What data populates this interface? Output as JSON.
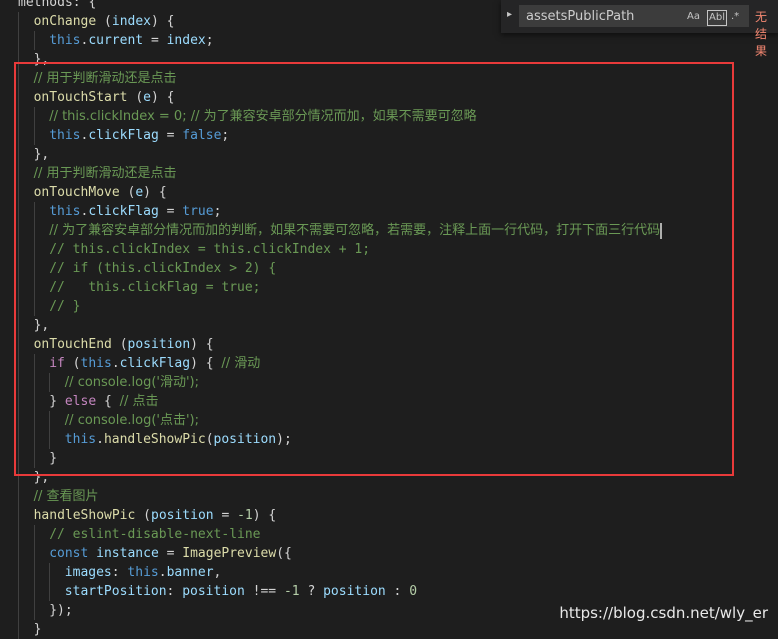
{
  "editor": {
    "lines": [
      {
        "indent": 0,
        "tokens": [
          {
            "t": "methods: {",
            "c": "pun"
          }
        ]
      },
      {
        "indent": 1,
        "tokens": [
          {
            "t": "onChange",
            "c": "fn"
          },
          {
            "t": " (",
            "c": "pun"
          },
          {
            "t": "index",
            "c": "key"
          },
          {
            "t": ") {",
            "c": "pun"
          }
        ]
      },
      {
        "indent": 2,
        "tokens": [
          {
            "t": "this",
            "c": "kw"
          },
          {
            "t": ".",
            "c": "pun"
          },
          {
            "t": "current",
            "c": "key"
          },
          {
            "t": " = ",
            "c": "pun"
          },
          {
            "t": "index",
            "c": "key"
          },
          {
            "t": ";",
            "c": "pun"
          }
        ]
      },
      {
        "indent": 1,
        "tokens": [
          {
            "t": "},",
            "c": "pun"
          }
        ]
      },
      {
        "indent": 1,
        "tokens": [
          {
            "t": "// 用于判断滑动还是点击",
            "c": "cm"
          }
        ]
      },
      {
        "indent": 1,
        "tokens": [
          {
            "t": "onTouchStart",
            "c": "fn"
          },
          {
            "t": " (",
            "c": "pun"
          },
          {
            "t": "e",
            "c": "key"
          },
          {
            "t": ") {",
            "c": "pun"
          }
        ]
      },
      {
        "indent": 2,
        "tokens": [
          {
            "t": "// this.clickIndex = 0; // 为了兼容安卓部分情况而加，如果不需要可忽略",
            "c": "cm"
          }
        ]
      },
      {
        "indent": 2,
        "tokens": [
          {
            "t": "this",
            "c": "kw"
          },
          {
            "t": ".",
            "c": "pun"
          },
          {
            "t": "clickFlag",
            "c": "key"
          },
          {
            "t": " = ",
            "c": "pun"
          },
          {
            "t": "false",
            "c": "kw"
          },
          {
            "t": ";",
            "c": "pun"
          }
        ]
      },
      {
        "indent": 1,
        "tokens": [
          {
            "t": "},",
            "c": "pun"
          }
        ]
      },
      {
        "indent": 1,
        "tokens": [
          {
            "t": "// 用于判断滑动还是点击",
            "c": "cm"
          }
        ]
      },
      {
        "indent": 1,
        "tokens": [
          {
            "t": "onTouchMove",
            "c": "fn"
          },
          {
            "t": " (",
            "c": "pun"
          },
          {
            "t": "e",
            "c": "key"
          },
          {
            "t": ") {",
            "c": "pun"
          }
        ]
      },
      {
        "indent": 2,
        "tokens": [
          {
            "t": "this",
            "c": "kw"
          },
          {
            "t": ".",
            "c": "pun"
          },
          {
            "t": "clickFlag",
            "c": "key"
          },
          {
            "t": " = ",
            "c": "pun"
          },
          {
            "t": "true",
            "c": "kw"
          },
          {
            "t": ";",
            "c": "pun"
          }
        ]
      },
      {
        "indent": 2,
        "cursor": true,
        "tokens": [
          {
            "t": "// 为了兼容安卓部分情况而加的判断，如果不需要可忽略，若需要，注释上面一行代码，打开下面三行代码",
            "c": "cm"
          }
        ]
      },
      {
        "indent": 2,
        "tokens": [
          {
            "t": "// this.clickIndex = this.clickIndex + 1;",
            "c": "cm"
          }
        ]
      },
      {
        "indent": 2,
        "tokens": [
          {
            "t": "// if (this.clickIndex > 2) {",
            "c": "cm"
          }
        ]
      },
      {
        "indent": 2,
        "tokens": [
          {
            "t": "//   this.clickFlag = true;",
            "c": "cm"
          }
        ]
      },
      {
        "indent": 2,
        "tokens": [
          {
            "t": "// }",
            "c": "cm"
          }
        ]
      },
      {
        "indent": 1,
        "tokens": [
          {
            "t": "},",
            "c": "pun"
          }
        ]
      },
      {
        "indent": 1,
        "tokens": [
          {
            "t": "onTouchEnd",
            "c": "fn"
          },
          {
            "t": " (",
            "c": "pun"
          },
          {
            "t": "position",
            "c": "key"
          },
          {
            "t": ") {",
            "c": "pun"
          }
        ]
      },
      {
        "indent": 2,
        "tokens": [
          {
            "t": "if",
            "c": "ctl"
          },
          {
            "t": " (",
            "c": "pun"
          },
          {
            "t": "this",
            "c": "kw"
          },
          {
            "t": ".",
            "c": "pun"
          },
          {
            "t": "clickFlag",
            "c": "key"
          },
          {
            "t": ") { ",
            "c": "pun"
          },
          {
            "t": "// 滑动",
            "c": "cm"
          }
        ]
      },
      {
        "indent": 3,
        "tokens": [
          {
            "t": "// console.log('滑动');",
            "c": "cm"
          }
        ]
      },
      {
        "indent": 2,
        "tokens": [
          {
            "t": "} ",
            "c": "pun"
          },
          {
            "t": "else",
            "c": "ctl"
          },
          {
            "t": " { ",
            "c": "pun"
          },
          {
            "t": "// 点击",
            "c": "cm"
          }
        ]
      },
      {
        "indent": 3,
        "tokens": [
          {
            "t": "// console.log('点击');",
            "c": "cm"
          }
        ]
      },
      {
        "indent": 3,
        "tokens": [
          {
            "t": "this",
            "c": "kw"
          },
          {
            "t": ".",
            "c": "pun"
          },
          {
            "t": "handleShowPic",
            "c": "fn"
          },
          {
            "t": "(",
            "c": "pun"
          },
          {
            "t": "position",
            "c": "key"
          },
          {
            "t": ");",
            "c": "pun"
          }
        ]
      },
      {
        "indent": 2,
        "tokens": [
          {
            "t": "}",
            "c": "pun"
          }
        ]
      },
      {
        "indent": 1,
        "tokens": [
          {
            "t": "},",
            "c": "pun"
          }
        ]
      },
      {
        "indent": 1,
        "tokens": [
          {
            "t": "// 查看图片",
            "c": "cm"
          }
        ]
      },
      {
        "indent": 1,
        "tokens": [
          {
            "t": "handleShowPic",
            "c": "fn"
          },
          {
            "t": " (",
            "c": "pun"
          },
          {
            "t": "position",
            "c": "key"
          },
          {
            "t": " = ",
            "c": "pun"
          },
          {
            "t": "-1",
            "c": "num"
          },
          {
            "t": ") {",
            "c": "pun"
          }
        ]
      },
      {
        "indent": 2,
        "tokens": [
          {
            "t": "// eslint-disable-next-line",
            "c": "cm"
          }
        ]
      },
      {
        "indent": 2,
        "tokens": [
          {
            "t": "const",
            "c": "kw"
          },
          {
            "t": " ",
            "c": "pun"
          },
          {
            "t": "instance",
            "c": "key"
          },
          {
            "t": " = ",
            "c": "pun"
          },
          {
            "t": "ImagePreview",
            "c": "fn"
          },
          {
            "t": "({",
            "c": "pun"
          }
        ]
      },
      {
        "indent": 3,
        "tokens": [
          {
            "t": "images",
            "c": "key"
          },
          {
            "t": ": ",
            "c": "pun"
          },
          {
            "t": "this",
            "c": "kw"
          },
          {
            "t": ".",
            "c": "pun"
          },
          {
            "t": "banner",
            "c": "key"
          },
          {
            "t": ",",
            "c": "pun"
          }
        ]
      },
      {
        "indent": 3,
        "tokens": [
          {
            "t": "startPosition",
            "c": "key"
          },
          {
            "t": ": ",
            "c": "pun"
          },
          {
            "t": "position",
            "c": "key"
          },
          {
            "t": " !== ",
            "c": "pun"
          },
          {
            "t": "-1",
            "c": "num"
          },
          {
            "t": " ? ",
            "c": "pun"
          },
          {
            "t": "position",
            "c": "key"
          },
          {
            "t": " : ",
            "c": "pun"
          },
          {
            "t": "0",
            "c": "num"
          }
        ]
      },
      {
        "indent": 2,
        "tokens": [
          {
            "t": "});",
            "c": "pun"
          }
        ]
      },
      {
        "indent": 1,
        "tokens": [
          {
            "t": "}",
            "c": "pun"
          }
        ]
      }
    ]
  },
  "search": {
    "query": "assetsPublicPath",
    "match_case": "Aa",
    "whole_word": "Abl",
    "regex": ".*",
    "result": "无结果"
  },
  "watermark": "https://blog.csdn.net/wly_er"
}
